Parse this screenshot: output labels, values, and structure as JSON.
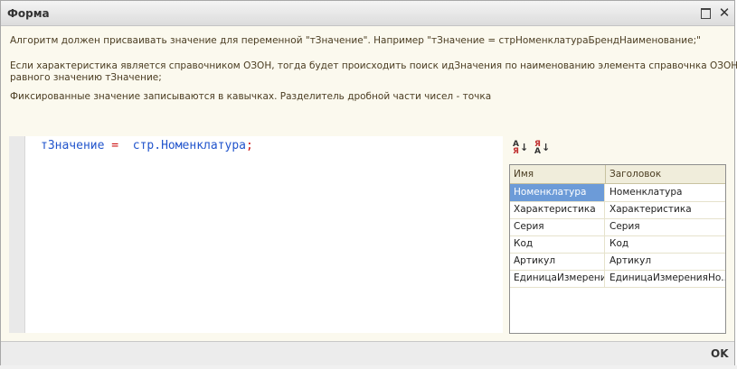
{
  "window": {
    "title": "Форма"
  },
  "description": {
    "line1": "Алгоритм должен присваивать значение для переменной \"тЗначение\". Например \"тЗначение = стрНоменклатураБрендНаименование;\"",
    "line2": "Если характеристика является справочником ОЗОН, тогда будет происходить поиск идЗначения по наименованию элемента справочнка ОЗОН",
    "line3": "равного значению тЗначение;",
    "line4": "Фиксированные значение записываются в кавычках. Разделитель дробной части чисел - точка"
  },
  "editor": {
    "code_var": "тЗначение",
    "code_eq": "=",
    "code_expr": "стр.Номенклатура",
    "code_end": ";"
  },
  "toolbar": {
    "sort_asc_icon": "sort-ascending-icon",
    "sort_desc_icon": "sort-descending-icon"
  },
  "table": {
    "headers": [
      "Имя",
      "Заголовок"
    ],
    "rows": [
      [
        "Номенклатура",
        "Номенклатура"
      ],
      [
        "Характеристика",
        "Характеристика"
      ],
      [
        "Серия",
        "Серия"
      ],
      [
        "Код",
        "Код"
      ],
      [
        "Артикул",
        "Артикул"
      ],
      [
        "ЕдиницаИзмерени...",
        "ЕдиницаИзмеренияНо..."
      ]
    ],
    "selected_color": "#6c9bd8"
  },
  "footer": {
    "ok_label": "OK"
  }
}
